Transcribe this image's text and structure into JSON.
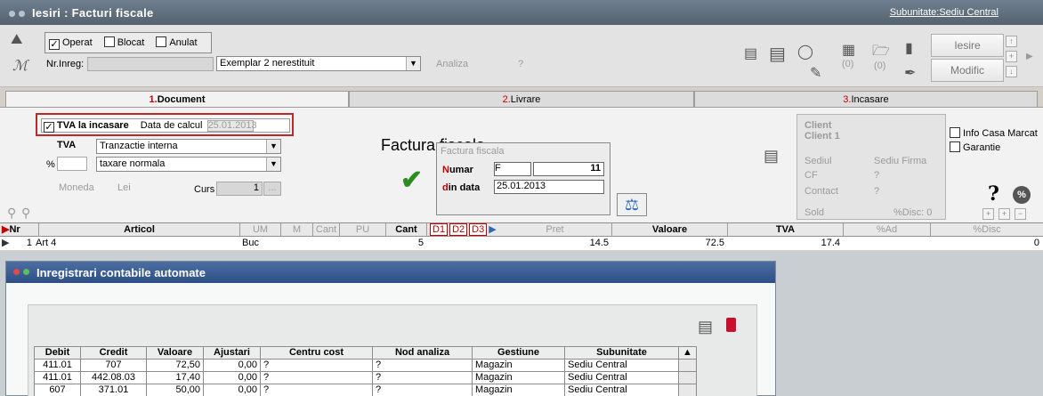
{
  "window": {
    "title": "Iesiri : Facturi fiscale",
    "subunit_link": "Subunitate:Sediu Central"
  },
  "toolbar": {
    "checkboxes": [
      {
        "label": "Operat",
        "checked": true
      },
      {
        "label": "Blocat",
        "checked": false
      },
      {
        "label": "Anulat",
        "checked": false
      }
    ],
    "nrinreg_label": "Nr.Inreg:",
    "nrinreg_value": "",
    "exemplar_value": "Exemplar 2 nerestituit",
    "analiza_label": "Analiza",
    "analiza_value": "?",
    "count_a": "(0)",
    "count_b": "(0)",
    "iesire_label": "Iesire",
    "modific_label": "Modific"
  },
  "tabs": [
    {
      "num": "1.",
      "label": "Document",
      "active": true
    },
    {
      "num": "2.",
      "label": "Livrare",
      "active": false
    },
    {
      "num": "3.",
      "label": "Incasare",
      "active": false
    }
  ],
  "document": {
    "tva_incasare_label": "TVA la incasare",
    "tva_incasare_checked": true,
    "data_calcul_label": "Data de calcul",
    "data_calcul_value": "25.01.2013",
    "tva_label": "TVA",
    "tva_value": "Tranzactie interna",
    "percent_label": "%",
    "percent_value": "",
    "taxare_value": "taxare normala",
    "moneda_label": "Moneda",
    "moneda_value": "Lei",
    "curs_label": "Curs",
    "curs_value": "1",
    "curs_button": "...",
    "factura_title": "Factura fiscala",
    "factura_group_label": "Factura fiscala",
    "numar_label_first": "N",
    "numar_label_rest": "umar",
    "numar_series": "F",
    "numar_value": "11",
    "data_label_first": "d",
    "data_label_rest": "in data",
    "data_value": "25.01.2013"
  },
  "client": {
    "title1": "Client",
    "title2": "Client 1",
    "sediul_label": "Sediul",
    "sediul_value": "Sediu Firma",
    "cf_label": "CF",
    "cf_value": "?",
    "contact_label": "Contact",
    "contact_value": "?",
    "sold_label": "Sold",
    "disc_label": "%Disc: 0",
    "info_casa_label": "Info Casa Marcat",
    "garantie_label": "Garantie"
  },
  "grid": {
    "headers": {
      "nr": "Nr",
      "articol": "Articol",
      "um": "UM",
      "mcorelat": "M corelat",
      "cant_corelat": "Cant corelat",
      "pu_corelat": "PU corelat",
      "cant": "Cant",
      "d1": "D1",
      "d2": "D2",
      "d3": "D3",
      "pret": "Pret",
      "valoare": "Valoare",
      "tva": "TVA",
      "ad": "%Ad",
      "disc": "%Disc"
    },
    "row": {
      "nr": "1",
      "articol": "Art 4",
      "um": "Buc",
      "cant": "5",
      "pret": "14.5",
      "valoare": "72.5",
      "tva": "17.4",
      "disc": "0"
    }
  },
  "dialog": {
    "title": "Inregistrari contabile automate",
    "columns": [
      "Debit",
      "Credit",
      "Valoare",
      "Ajustari",
      "Centru cost",
      "Nod analiza",
      "Gestiune",
      "Subunitate"
    ],
    "rows": [
      [
        "411.01",
        "707",
        "72,50",
        "0,00",
        "?",
        "?",
        "Magazin",
        "Sediu Central"
      ],
      [
        "411.01",
        "442.08.03",
        "17,40",
        "0,00",
        "?",
        "?",
        "Magazin",
        "Sediu Central"
      ],
      [
        "607",
        "371.01",
        "50,00",
        "0,00",
        "?",
        "?",
        "Magazin",
        "Sediu Central"
      ]
    ]
  },
  "colors": {
    "title_bar": "#5f6d7a",
    "dialog_title": "#3a5d92",
    "accent_red": "#c00000",
    "highlight_border": "#c0272d",
    "checkmark_green": "#2e8b22"
  }
}
